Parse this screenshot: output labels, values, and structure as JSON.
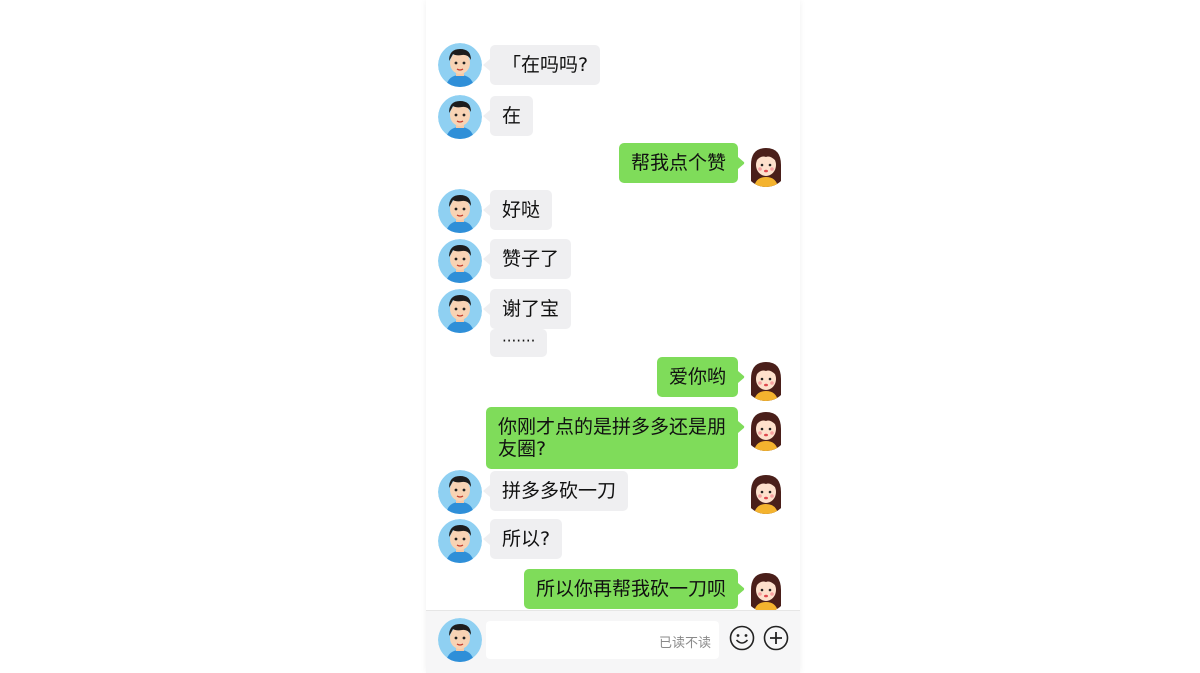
{
  "colors": {
    "incoming_bubble": "#efeff1",
    "outgoing_bubble": "#7fdc5a",
    "male_avatar_bg": "#8fd0f2",
    "female_avatar_bg": "#ffffff"
  },
  "messages": [
    {
      "sender": "male",
      "text": "「在吗吗?"
    },
    {
      "sender": "male",
      "text": "在"
    },
    {
      "sender": "female",
      "text": "帮我点个赞"
    },
    {
      "sender": "male",
      "text": "好哒"
    },
    {
      "sender": "male",
      "text": "赞子了"
    },
    {
      "sender": "male",
      "text": "谢了宝"
    },
    {
      "sender": "male",
      "text": "·······"
    },
    {
      "sender": "female",
      "text": "爱你哟"
    },
    {
      "sender": "female",
      "text": "你刚才点的是拼多多还是朋友圈?"
    },
    {
      "sender": "male",
      "text": "拼多多砍一刀"
    },
    {
      "sender": "male",
      "text": "所以?"
    },
    {
      "sender": "female",
      "text": "所以你再帮我砍一刀呗"
    }
  ],
  "input_bar": {
    "read_status": "已读不读",
    "icons": [
      "emoji-icon",
      "plus-icon"
    ]
  }
}
